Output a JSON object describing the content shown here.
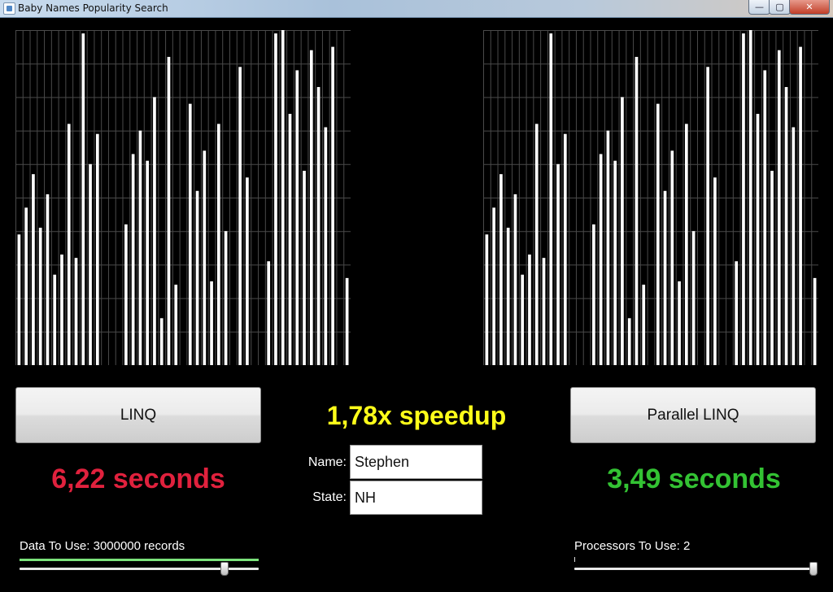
{
  "window": {
    "title": "Baby Names Popularity Search",
    "minimize": "—",
    "maximize": "▢",
    "close": "✕"
  },
  "linq": {
    "button_label": "LINQ",
    "time_text": "6,22 seconds",
    "time_color": "#e0213d"
  },
  "plinq": {
    "button_label": "Parallel LINQ",
    "time_text": "3,49 seconds",
    "time_color": "#33c233"
  },
  "speedup": {
    "text": "1,78x speedup",
    "color": "#ffff1a"
  },
  "form": {
    "name_label": "Name:",
    "name_value": "Stephen",
    "state_label": "State:",
    "state_value": "NH"
  },
  "data_slider": {
    "label": "Data To Use: 3000000 records",
    "fraction": 0.84
  },
  "proc_slider": {
    "label": "Processors To Use: 2",
    "fraction": 1.0
  },
  "chart_data": [
    {
      "type": "bar",
      "ylim": [
        0,
        100
      ],
      "grid": true,
      "values": [
        39,
        47,
        57,
        41,
        51,
        27,
        33,
        72,
        32,
        99,
        60,
        69,
        0,
        0,
        0,
        42,
        63,
        70,
        61,
        80,
        14,
        92,
        24,
        0,
        78,
        52,
        64,
        25,
        72,
        40,
        0,
        89,
        56,
        0,
        0,
        31,
        99,
        100,
        75,
        88,
        58,
        94,
        83,
        71,
        95,
        0,
        26
      ],
      "bar_color": "#ffffff"
    },
    {
      "type": "bar",
      "ylim": [
        0,
        100
      ],
      "grid": true,
      "values": [
        39,
        47,
        57,
        41,
        51,
        27,
        33,
        72,
        32,
        99,
        60,
        69,
        0,
        0,
        0,
        42,
        63,
        70,
        61,
        80,
        14,
        92,
        24,
        0,
        78,
        52,
        64,
        25,
        72,
        40,
        0,
        89,
        56,
        0,
        0,
        31,
        99,
        100,
        75,
        88,
        58,
        94,
        83,
        71,
        95,
        0,
        26
      ],
      "bar_color": "#ffffff"
    }
  ]
}
